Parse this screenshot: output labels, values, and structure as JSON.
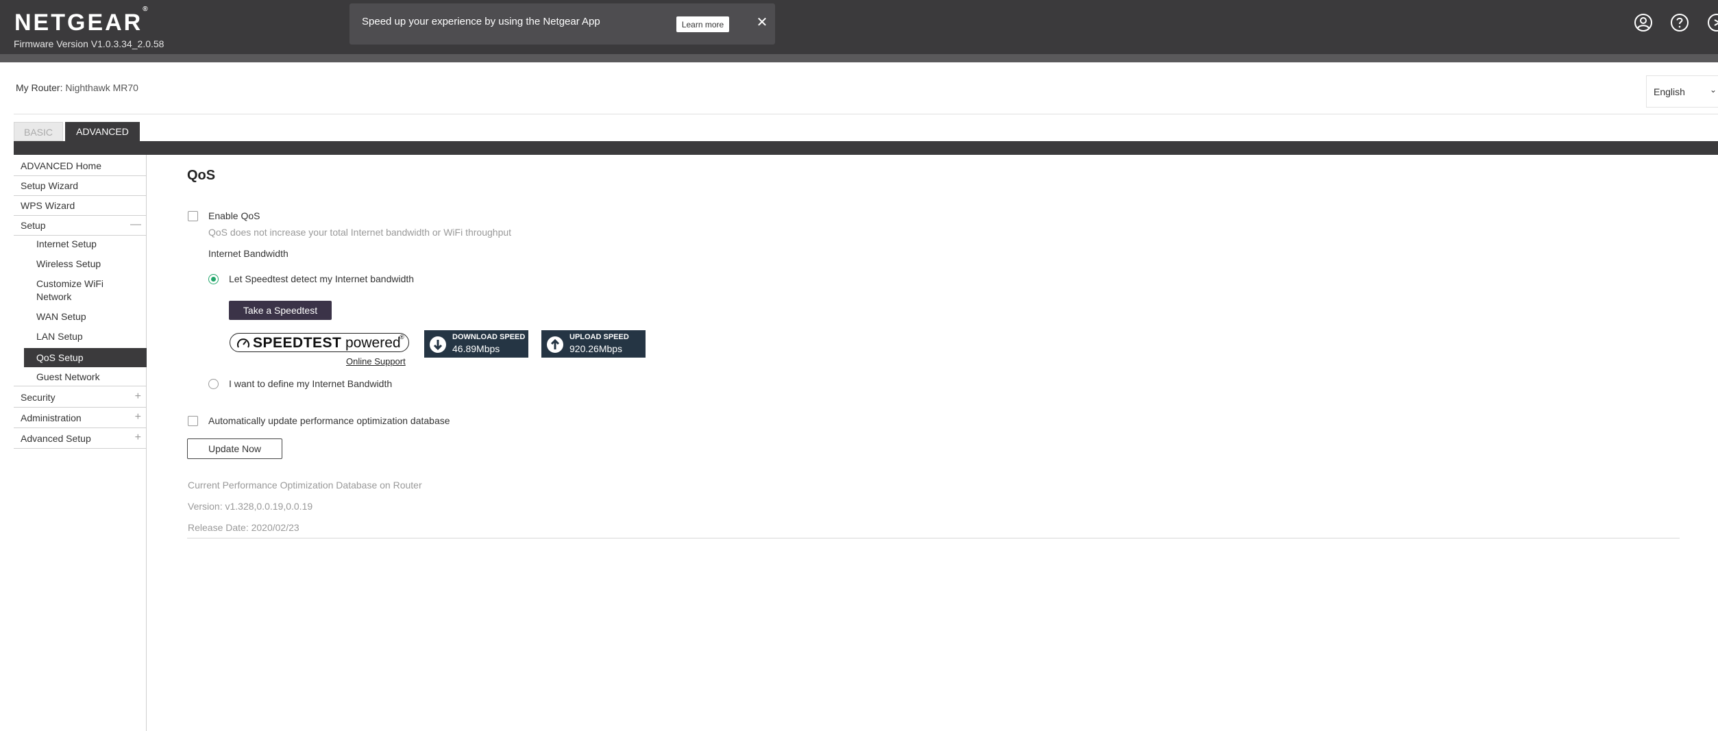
{
  "header": {
    "brand": "NETGEAR",
    "trademark": "®",
    "firmware": "Firmware Version V1.0.3.34_2.0.58",
    "promo_text": "Speed up your experience by using the Netgear App",
    "promo_button": "Learn more",
    "promo_close": "✕",
    "icons": [
      "user-account-icon",
      "help-icon",
      "logout-icon"
    ]
  },
  "router": {
    "label": "My Router:",
    "name": "Nighthawk MR70"
  },
  "language": {
    "selected": "English",
    "chevron": "⌄"
  },
  "tabs": {
    "basic": "BASIC",
    "advanced": "ADVANCED"
  },
  "sidebar": {
    "items": [
      {
        "label": "ADVANCED Home"
      },
      {
        "label": "Setup Wizard"
      },
      {
        "label": "WPS Wizard"
      },
      {
        "label": "Setup",
        "sign": "—"
      },
      {
        "label": "Internet Setup"
      },
      {
        "label": "Wireless Setup"
      },
      {
        "label": "Customize WiFi Network"
      },
      {
        "label": "WAN Setup"
      },
      {
        "label": "LAN Setup"
      },
      {
        "label": "QoS Setup"
      },
      {
        "label": "Guest Network"
      },
      {
        "label": "Security",
        "sign": "+"
      },
      {
        "label": "Administration",
        "sign": "+"
      },
      {
        "label": "Advanced Setup",
        "sign": "+"
      }
    ]
  },
  "main": {
    "title": "QoS",
    "enable_qos": "Enable QoS",
    "enable_qos_hint": "QoS does not increase your total Internet bandwidth or WiFi throughput",
    "bandwidth_heading": "Internet Bandwidth",
    "radio_speedtest": "Let Speedtest detect my Internet bandwidth",
    "speedtest_button": "Take a Speedtest",
    "speedtest_logo_word": "SPEEDTEST",
    "speedtest_logo_powered": "powered",
    "speedtest_logo_mark": "®",
    "online_support": "Online Support",
    "download_label": "DOWNLOAD SPEED",
    "download_value": "46.89Mbps",
    "upload_label": "UPLOAD SPEED",
    "upload_value": "920.26Mbps",
    "radio_define": "I want to define my Internet Bandwidth",
    "auto_update": "Automatically update performance optimization database",
    "update_button": "Update Now",
    "db_heading": "Current Performance Optimization Database on Router",
    "db_version": "Version: v1.328,0.0.19,0.0.19",
    "db_release": "Release Date: 2020/02/23"
  },
  "colors": {
    "header_bg": "#3b3a3c",
    "accent_green": "#23a66b",
    "speed_box_bg": "#253544",
    "dark_button": "#3b3348"
  }
}
